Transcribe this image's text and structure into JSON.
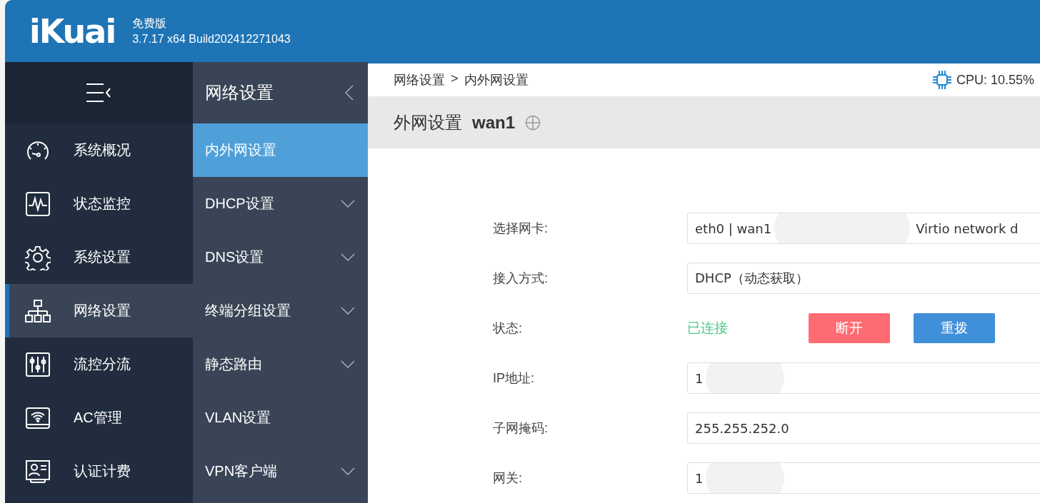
{
  "header": {
    "logo": "iKuai",
    "edition": "免费版",
    "version": "3.7.17 x64 Build202412271043"
  },
  "primary_nav": {
    "items": [
      {
        "label": "系统概况",
        "selected": false
      },
      {
        "label": "状态监控",
        "selected": false
      },
      {
        "label": "系统设置",
        "selected": false
      },
      {
        "label": "网络设置",
        "selected": true
      },
      {
        "label": "流控分流",
        "selected": false
      },
      {
        "label": "AC管理",
        "selected": false
      },
      {
        "label": "认证计费",
        "selected": false
      }
    ]
  },
  "secondary_nav": {
    "title": "网络设置",
    "items": [
      {
        "label": "内外网设置",
        "selected": true,
        "expandable": false
      },
      {
        "label": "DHCP设置",
        "selected": false,
        "expandable": true
      },
      {
        "label": "DNS设置",
        "selected": false,
        "expandable": true
      },
      {
        "label": "终端分组设置",
        "selected": false,
        "expandable": true
      },
      {
        "label": "静态路由",
        "selected": false,
        "expandable": true
      },
      {
        "label": "VLAN设置",
        "selected": false,
        "expandable": false
      },
      {
        "label": "VPN客户端",
        "selected": false,
        "expandable": true
      }
    ]
  },
  "breadcrumb": [
    "网络设置",
    ">",
    "内外网设置"
  ],
  "cpu": "CPU: 10.55%",
  "section": {
    "title": "外网设置",
    "interface": "wan1"
  },
  "form": [
    {
      "kind": "field",
      "label": "选择网卡:",
      "value": "eth0 | wan1",
      "value_after": "Virtio network d",
      "redacted": true
    },
    {
      "kind": "field",
      "label": "接入方式:",
      "value": "DHCP（动态获取）",
      "redacted": false
    },
    {
      "kind": "status",
      "label": "状态:",
      "value": "已连接",
      "buttons": [
        {
          "label": "断开",
          "color": "#ff6b72"
        },
        {
          "label": "重拨",
          "color": "#3f8fd9"
        }
      ]
    },
    {
      "kind": "field",
      "label": "IP地址:",
      "value": "1",
      "redacted": true
    },
    {
      "kind": "field",
      "label": "子网掩码:",
      "value": "255.255.252.0",
      "redacted": false
    },
    {
      "kind": "field",
      "label": "网关:",
      "value": "1",
      "redacted": true
    }
  ]
}
